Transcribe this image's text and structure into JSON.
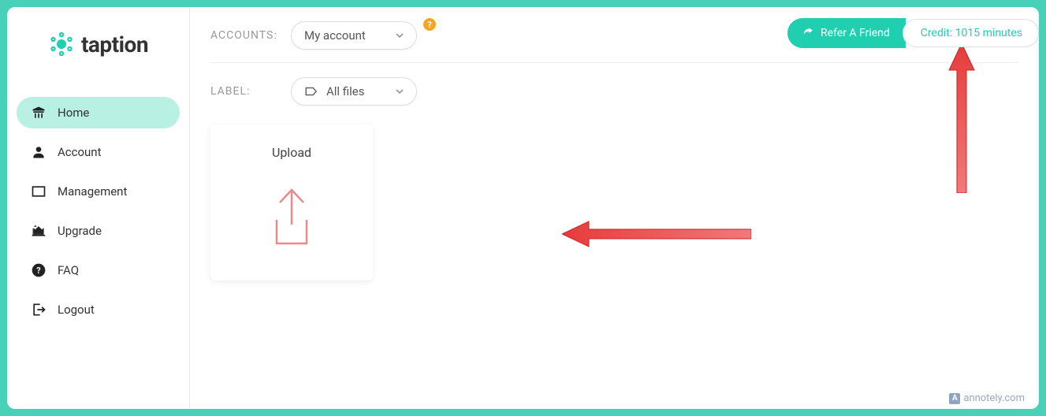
{
  "brand": {
    "name": "taption"
  },
  "sidebar": {
    "items": [
      {
        "label": "Home"
      },
      {
        "label": "Account"
      },
      {
        "label": "Management"
      },
      {
        "label": "Upgrade"
      },
      {
        "label": "FAQ"
      },
      {
        "label": "Logout"
      }
    ]
  },
  "header": {
    "accounts_label": "ACCOUNTS:",
    "account_selected": "My account",
    "refer_label": "Refer A Friend",
    "credit_label": "Credit: 1015 minutes"
  },
  "filters": {
    "label_label": "LABEL:",
    "label_selected": "All files"
  },
  "upload": {
    "title": "Upload"
  },
  "watermark": {
    "text": "annotely.com"
  }
}
